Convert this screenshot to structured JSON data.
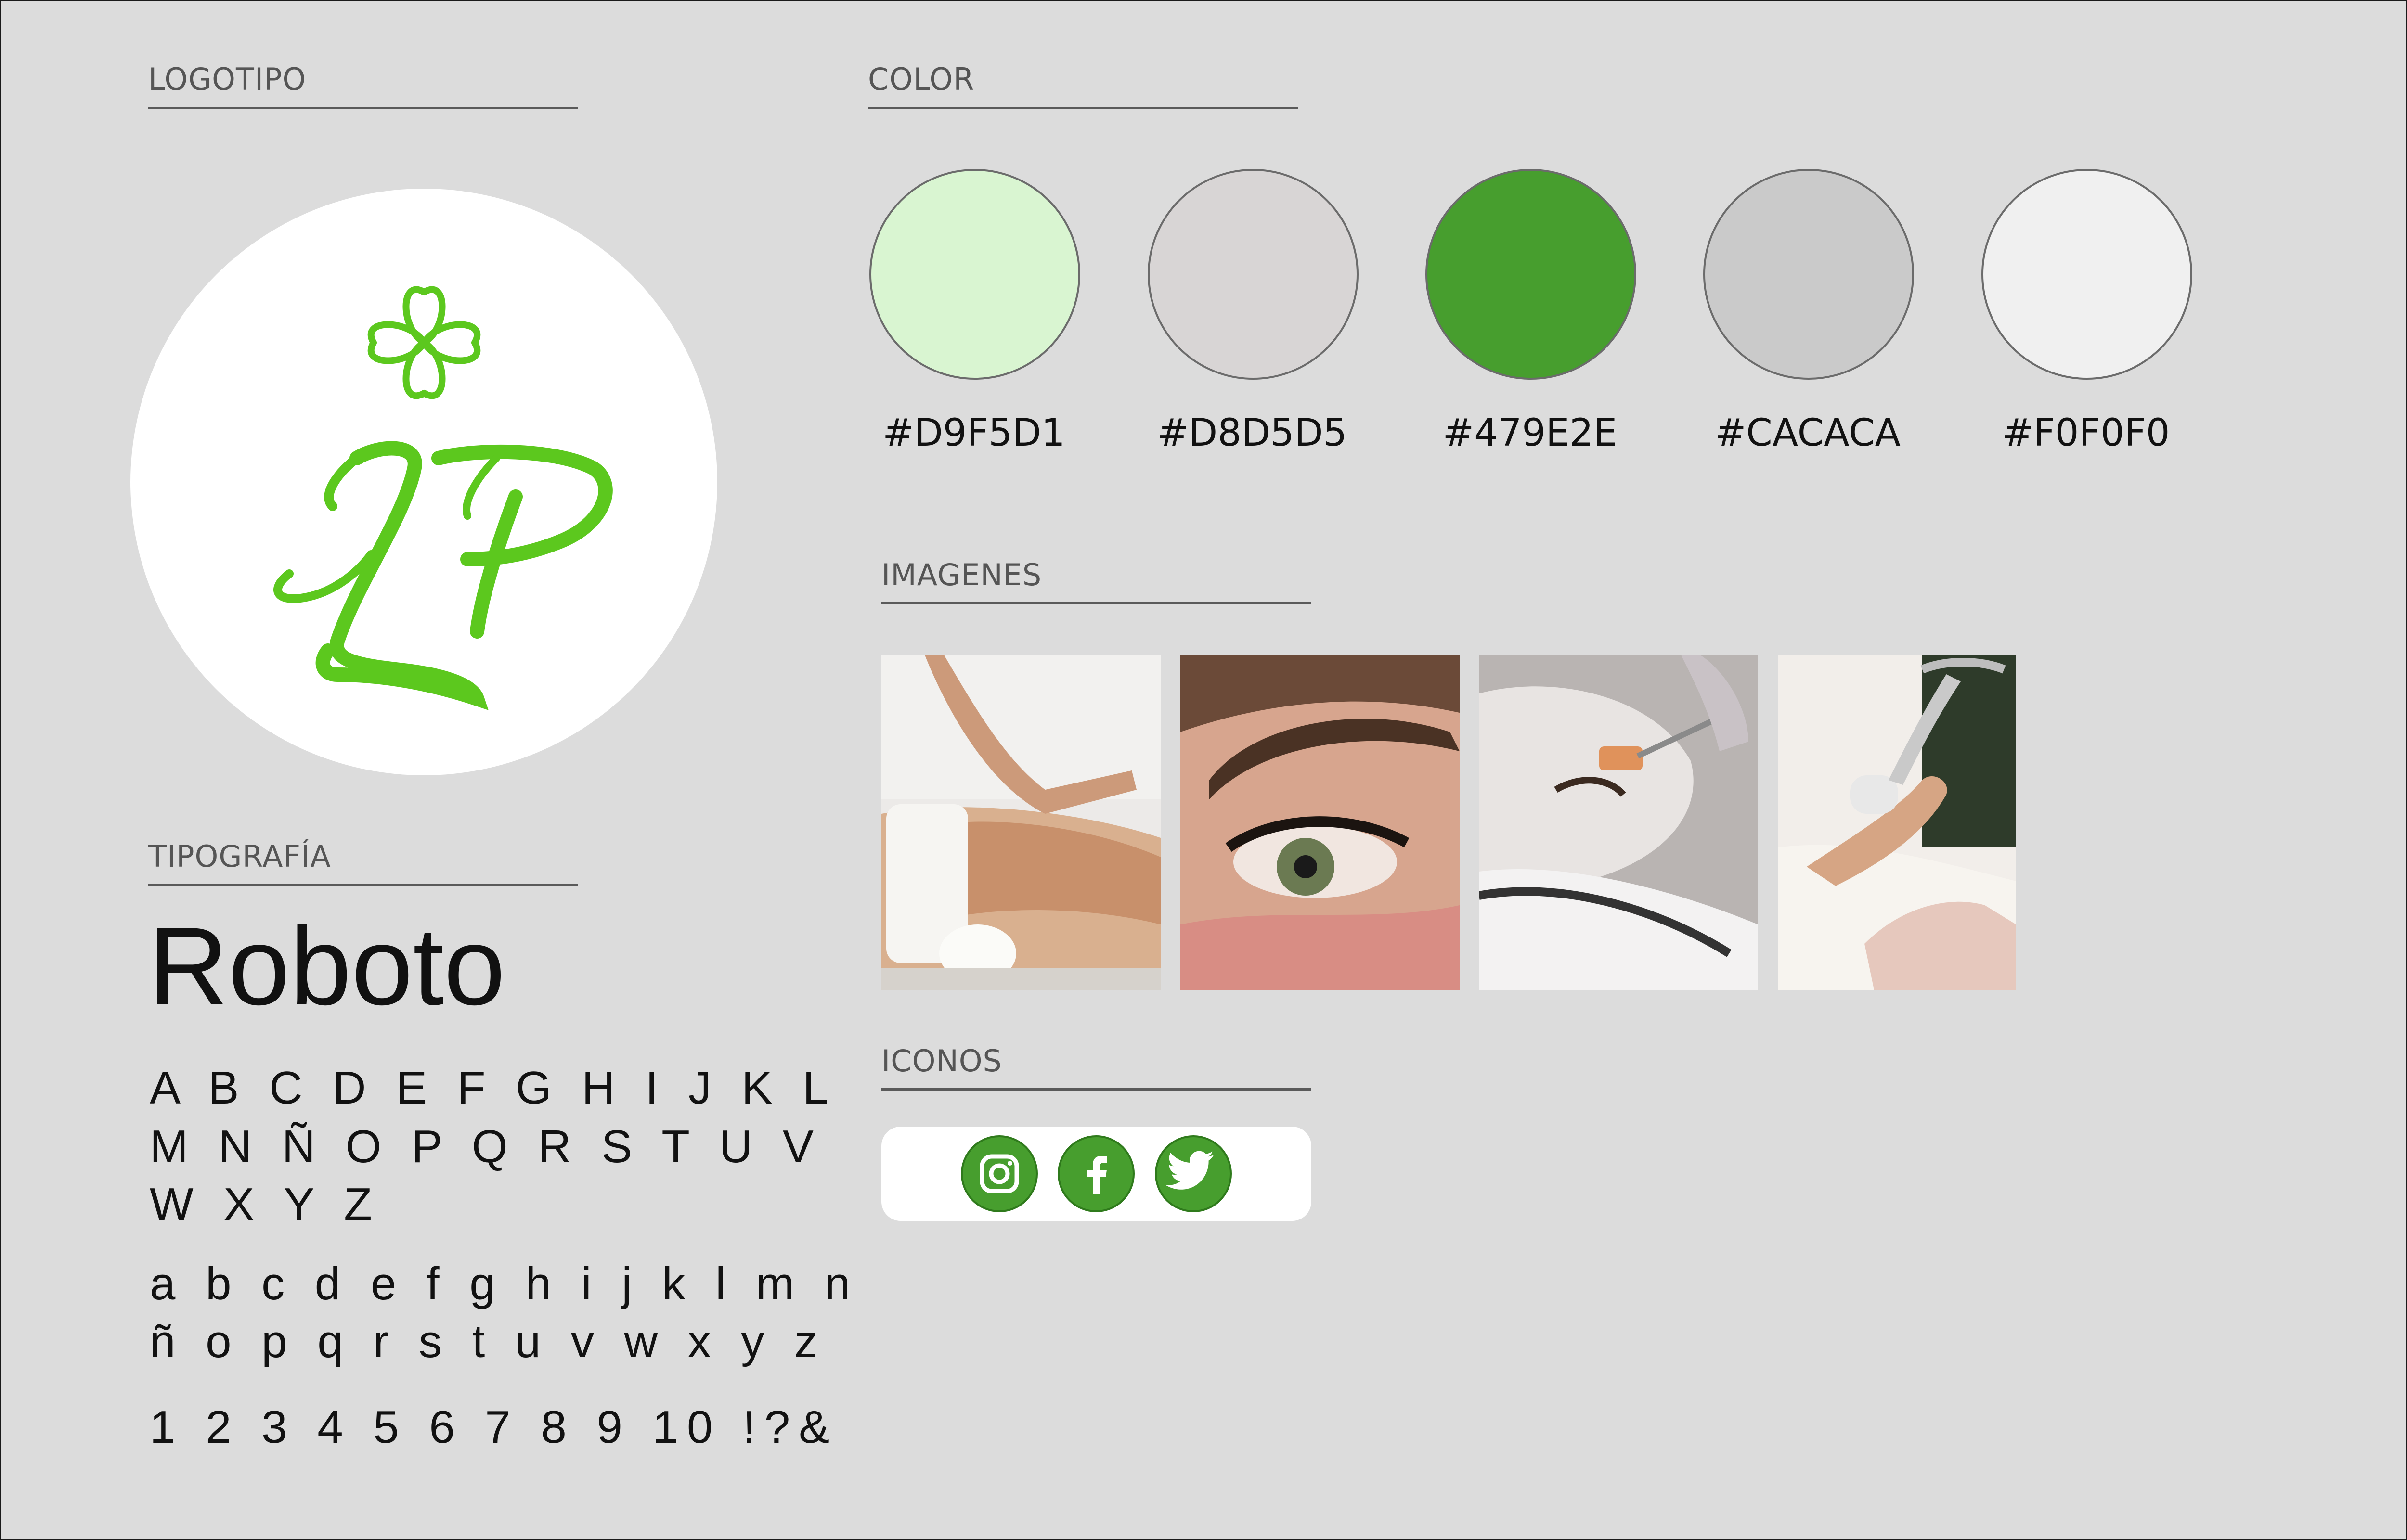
{
  "sections": {
    "logo": "LOGOTIPO",
    "color": "COLOR",
    "images": "IMAGENES",
    "icons": "ICONOS",
    "typography": "TIPOGRAFÍA"
  },
  "colors": [
    {
      "hex": "#D9F5D1",
      "label": "#D9F5D1"
    },
    {
      "hex": "#D8D5D5",
      "label": "#D8D5D5"
    },
    {
      "hex": "#479E2E",
      "label": "#479E2E"
    },
    {
      "hex": "#CACACA",
      "label": "#CACACA"
    },
    {
      "hex": "#F0F0F0",
      "label": "#F0F0F0"
    }
  ],
  "logo": {
    "monogram": "LP",
    "brand_color": "#5cc81e",
    "emblem": "four-leaf-clover"
  },
  "images": [
    {
      "subject": "back massage"
    },
    {
      "subject": "eyelash close-up"
    },
    {
      "subject": "facial mask treatment"
    },
    {
      "subject": "leg treatment device"
    }
  ],
  "icons": [
    {
      "name": "instagram-icon"
    },
    {
      "name": "facebook-icon"
    },
    {
      "name": "twitter-icon"
    }
  ],
  "typography": {
    "font_name": "Roboto",
    "uppercase": [
      "A B C D E F G H I J K L",
      "M N Ñ O P Q R S T U V",
      "W X Y Z"
    ],
    "lowercase": [
      "a b c d e f g h i j k l m n",
      "ñ o p q r s t u v w x y z"
    ],
    "numbers": "1 2 3 4 5 6 7 8 9 10 !?&"
  }
}
